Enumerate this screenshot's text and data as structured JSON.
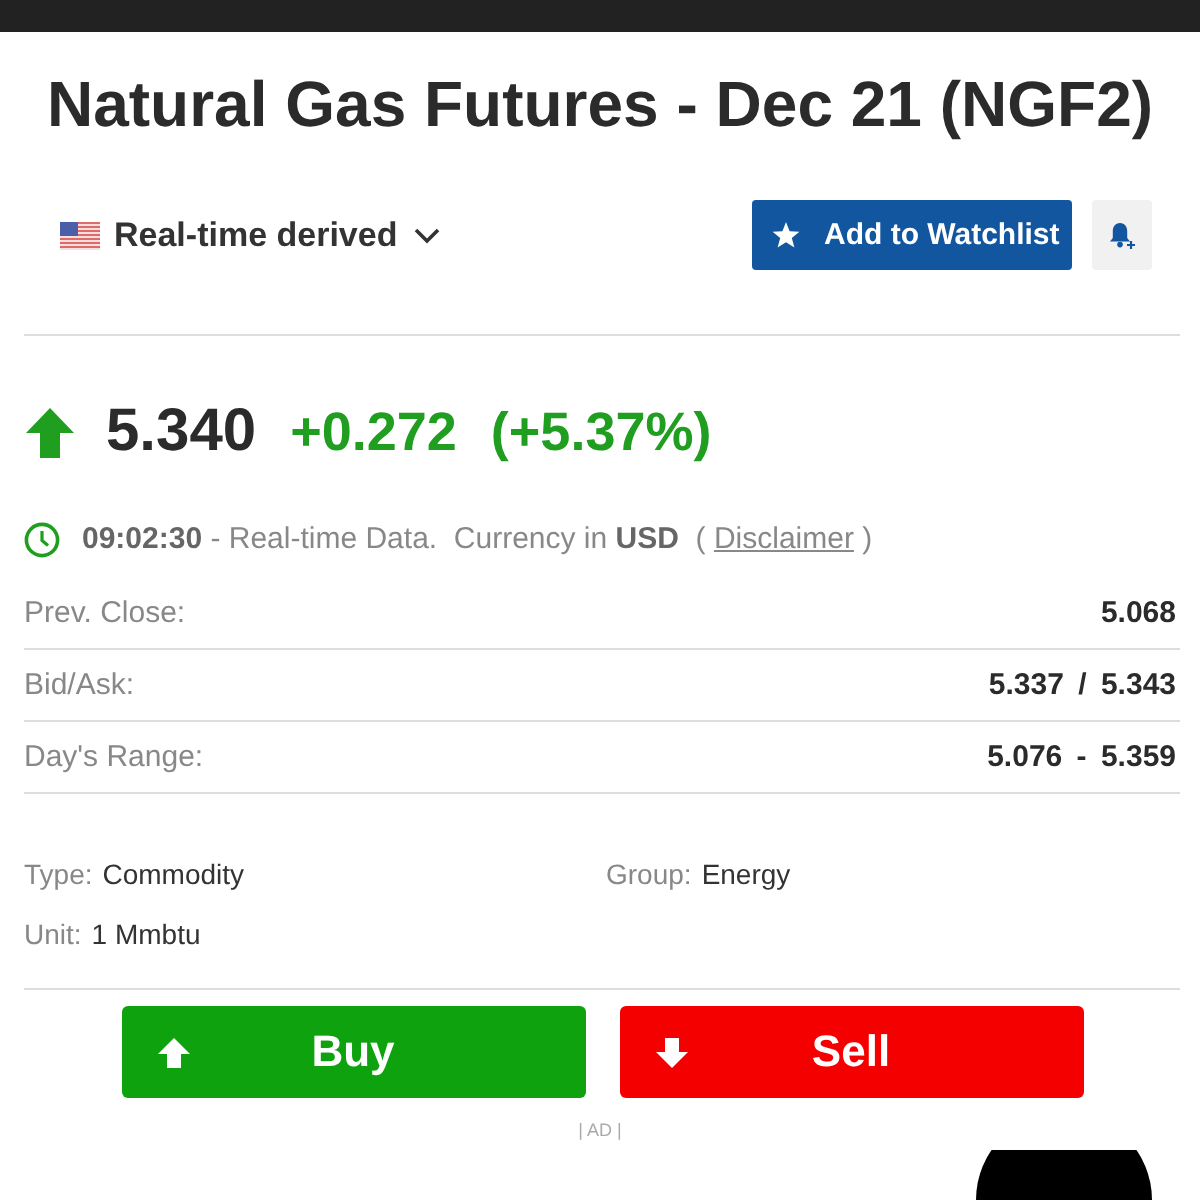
{
  "title": "Natural Gas Futures - Dec 21 (NGF2)",
  "toolbar": {
    "source_label": "Real-time derived",
    "watchlist_button": "Add to Watchlist"
  },
  "quote": {
    "rising": true,
    "price": "5.340",
    "change": "+0.272",
    "change_percent": "(+5.37%)"
  },
  "status": {
    "text": "**09:02:30** - Real-time Data.  Currency in **USD**  ( ",
    "link": "Disclaimer",
    "text_after": " )"
  },
  "stats": [
    {
      "label": "Prev. Close:",
      "value": "5.068"
    },
    {
      "label": "Bid/Ask:",
      "value": "5.337 / 5.343"
    },
    {
      "label": "Day's Range:",
      "value": "5.076 - 5.359"
    }
  ],
  "details": [
    {
      "label": "Type:",
      "value": "Commodity"
    },
    {
      "label": "Group:",
      "value": "Energy"
    },
    {
      "label": "Unit:",
      "value": "1 Mmbtu"
    }
  ],
  "trade_buttons": [
    {
      "kind": "buy",
      "label": "Buy"
    },
    {
      "kind": "sell",
      "label": "Sell"
    }
  ],
  "ad_label": "| AD |"
}
